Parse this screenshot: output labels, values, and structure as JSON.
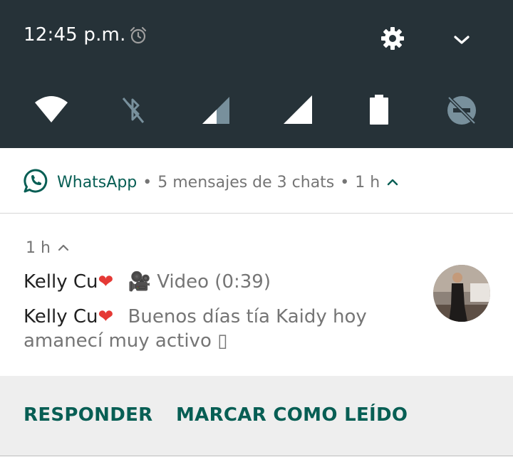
{
  "status_bar": {
    "time": "12:45 p.m.",
    "icons": [
      "alarm-icon",
      "settings-gear-icon",
      "expand-chevron-icon"
    ]
  },
  "quick_settings": {
    "tiles": [
      "wifi-icon",
      "bluetooth-off-icon",
      "signal-partial-icon",
      "signal-full-icon",
      "battery-icon",
      "do-not-disturb-off-icon"
    ]
  },
  "notification": {
    "app_name": "WhatsApp",
    "summary": "5 mensajes de 3 chats",
    "header_time": "1 h",
    "body_time": "1 h",
    "messages": [
      {
        "sender": "Kelly Cu",
        "heart": "❤",
        "media_icon": "🎥",
        "text": "Video (0:39)"
      },
      {
        "sender": "Kelly Cu",
        "heart": "❤",
        "text": "Buenos días tía Kaidy hoy amanecí muy activo",
        "trailing_glyph": "▯"
      }
    ],
    "actions": {
      "reply": "RESPONDER",
      "mark_read": "MARCAR COMO LEÍDO"
    }
  },
  "colors": {
    "shade_bg": "#263238",
    "whatsapp_green": "#075e54",
    "heart_red": "#e53935",
    "secondary_text": "#757575",
    "actions_bg": "#eeeeee"
  }
}
